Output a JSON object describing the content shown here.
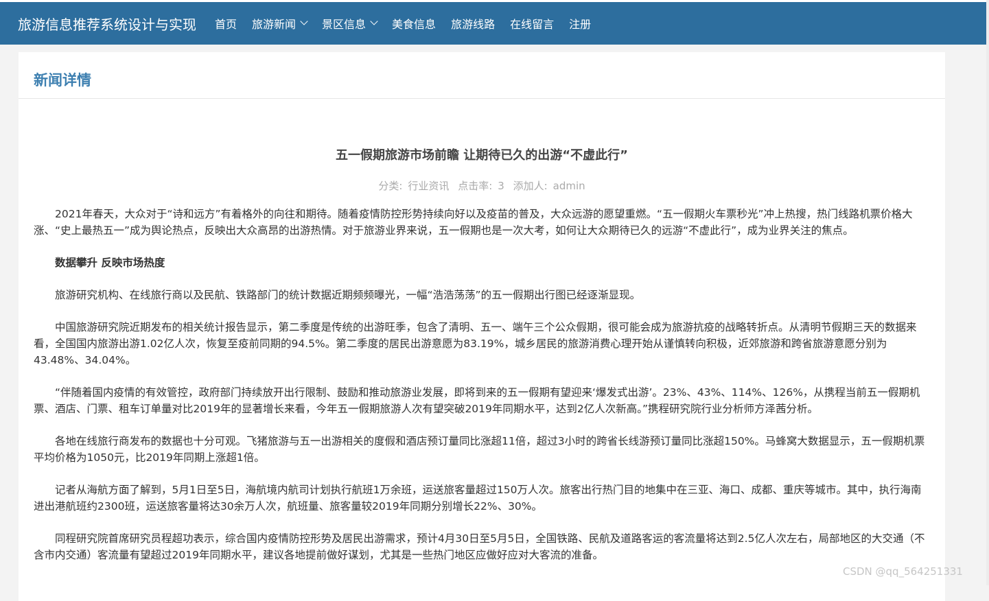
{
  "header": {
    "brand": "旅游信息推荐系统设计与实现",
    "nav": [
      {
        "label": "首页",
        "dropdown": false
      },
      {
        "label": "旅游新闻",
        "dropdown": true
      },
      {
        "label": "景区信息",
        "dropdown": true
      },
      {
        "label": "美食信息",
        "dropdown": false
      },
      {
        "label": "旅游线路",
        "dropdown": false
      },
      {
        "label": "在线留言",
        "dropdown": false
      },
      {
        "label": "注册",
        "dropdown": false
      }
    ]
  },
  "panel": {
    "title": "新闻详情"
  },
  "article": {
    "title": "五一假期旅游市场前瞻 让期待已久的出游“不虚此行”",
    "meta": {
      "category_label": "分类:",
      "category": "行业资讯",
      "clicks_label": "点击率:",
      "clicks": "3",
      "author_label": "添加人:",
      "author": "admin"
    },
    "paragraphs": [
      {
        "text": "2021年春天，大众对于“诗和远方”有着格外的向往和期待。随着疫情防控形势持续向好以及疫苗的普及，大众远游的愿望重燃。“五一假期火车票秒光”冲上热搜，热门线路机票价格大涨、“史上最热五一”成为舆论热点，反映出大众高昂的出游热情。对于旅游业界来说，五一假期也是一次大考，如何让大众期待已久的远游“不虚此行”，成为业界关注的焦点。",
        "bold": false
      },
      {
        "text": "数据攀升 反映市场热度",
        "bold": true
      },
      {
        "text": "旅游研究机构、在线旅行商以及民航、铁路部门的统计数据近期频频曝光，一幅“浩浩荡荡”的五一假期出行图已经逐渐显现。",
        "bold": false
      },
      {
        "text": "中国旅游研究院近期发布的相关统计报告显示，第二季度是传统的出游旺季，包含了清明、五一、端午三个公众假期，很可能会成为旅游抗疫的战略转折点。从清明节假期三天的数据来看，全国国内旅游出游1.02亿人次，恢复至疫前同期的94.5%。第二季度的居民出游意愿为83.19%，城乡居民的旅游消费心理开始从谨慎转向积极，近郊旅游和跨省旅游意愿分别为43.48%、34.04%。",
        "bold": false
      },
      {
        "text": "“伴随着国内疫情的有效管控，政府部门持续放开出行限制、鼓励和推动旅游业发展，即将到来的五一假期有望迎来‘爆发式出游’。23%、43%、114%、126%，从携程当前五一假期机票、酒店、门票、租车订单量对比2019年的显著增长来看，今年五一假期旅游人次有望突破2019年同期水平，达到2亿人次新高。”携程研究院行业分析师方泽茜分析。",
        "bold": false
      },
      {
        "text": "各地在线旅行商发布的数据也十分可观。飞猪旅游与五一出游相关的度假和酒店预订量同比涨超11倍，超过3小时的跨省长线游预订量同比涨超150%。马蜂窝大数据显示，五一假期机票平均价格为1050元，比2019年同期上涨超1倍。",
        "bold": false
      },
      {
        "text": "记者从海航方面了解到，5月1日至5日，海航境内航司计划执行航班1万余班，运送旅客量超过150万人次。旅客出行热门目的地集中在三亚、海口、成都、重庆等城市。其中，执行海南进出港航班约2300班，运送旅客量将达30余万人次，航班量、旅客量较2019年同期分别增长22%、30%。",
        "bold": false
      },
      {
        "text": "同程研究院首席研究员程超功表示，综合国内疫情防控形势及居民出游需求，预计4月30日至5月5日，全国铁路、民航及道路客运的客流量将达到2.5亿人次左右，局部地区的大交通（不含市内交通）客流量有望超过2019年同期水平，建议各地提前做好谋划，尤其是一些热门地区应做好应对大客流的准备。",
        "bold": false
      }
    ]
  },
  "watermark": "CSDN @qq_564251331"
}
